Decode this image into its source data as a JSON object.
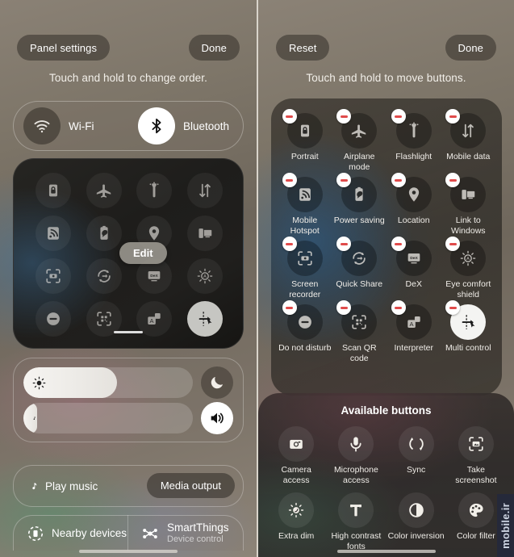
{
  "left_panel": {
    "panel_settings_label": "Panel settings",
    "done_label": "Done",
    "hint": "Touch and hold to change order.",
    "wifi": {
      "label": "Wi-Fi",
      "icon": "wifi-icon",
      "state": "off"
    },
    "bluetooth": {
      "label": "Bluetooth",
      "icon": "bluetooth-icon",
      "state": "on"
    },
    "edit_bubble_label": "Edit",
    "quick_grid": [
      {
        "icon": "portrait-lock-icon",
        "name": "portrait",
        "state": "off"
      },
      {
        "icon": "airplane-icon",
        "name": "airplane-mode",
        "state": "off"
      },
      {
        "icon": "flashlight-icon",
        "name": "flashlight",
        "state": "off"
      },
      {
        "icon": "mobile-data-icon",
        "name": "mobile-data",
        "state": "off"
      },
      {
        "icon": "hotspot-icon",
        "name": "mobile-hotspot",
        "state": "off"
      },
      {
        "icon": "power-saving-icon",
        "name": "power-saving",
        "state": "off"
      },
      {
        "icon": "location-pin-icon",
        "name": "location",
        "state": "off"
      },
      {
        "icon": "link-to-windows-icon",
        "name": "link-to-windows",
        "state": "off"
      },
      {
        "icon": "screen-recorder-icon",
        "name": "screen-recorder",
        "state": "off"
      },
      {
        "icon": "quick-share-icon",
        "name": "quick-share",
        "state": "off"
      },
      {
        "icon": "dex-icon",
        "name": "dex",
        "state": "off"
      },
      {
        "icon": "eye-comfort-shield-icon",
        "name": "eye-comfort-shield",
        "state": "off"
      },
      {
        "icon": "do-not-disturb-icon",
        "name": "do-not-disturb",
        "state": "off"
      },
      {
        "icon": "scan-qr-icon",
        "name": "scan-qr-code",
        "state": "off"
      },
      {
        "icon": "interpreter-icon",
        "name": "interpreter",
        "state": "off"
      },
      {
        "icon": "multi-control-icon",
        "name": "multi-control",
        "state": "on"
      }
    ],
    "brightness_slider": {
      "icon": "brightness-icon",
      "value_percent": 55,
      "side_icon": "moon-icon"
    },
    "volume_slider": {
      "icon": "media-note-icon",
      "value_percent": 8,
      "side_icon": "speaker-icon"
    },
    "media": {
      "play_music_label": "Play music",
      "note_icon": "music-note-icon",
      "media_output_label": "Media output"
    },
    "devices": {
      "nearby_label": "Nearby devices",
      "nearby_icon": "nearby-devices-icon",
      "smartthings_label": "SmartThings",
      "smartthings_sub": "Device control",
      "smartthings_icon": "smartthings-icon"
    }
  },
  "right_panel": {
    "reset_label": "Reset",
    "done_label": "Done",
    "hint": "Touch and hold to move buttons.",
    "active_buttons": [
      {
        "label": "Portrait",
        "icon": "portrait-lock-icon",
        "removable": true,
        "highlighted": false
      },
      {
        "label": "Airplane mode",
        "icon": "airplane-icon",
        "removable": true,
        "highlighted": false
      },
      {
        "label": "Flashlight",
        "icon": "flashlight-icon",
        "removable": true,
        "highlighted": false
      },
      {
        "label": "Mobile data",
        "icon": "mobile-data-icon",
        "removable": true,
        "highlighted": false
      },
      {
        "label": "Mobile Hotspot",
        "icon": "hotspot-icon",
        "removable": true,
        "highlighted": false
      },
      {
        "label": "Power saving",
        "icon": "power-saving-icon",
        "removable": true,
        "highlighted": false
      },
      {
        "label": "Location",
        "icon": "location-pin-icon",
        "removable": true,
        "highlighted": false
      },
      {
        "label": "Link to Windows",
        "icon": "link-to-windows-icon",
        "removable": true,
        "highlighted": false
      },
      {
        "label": "Screen recorder",
        "icon": "screen-recorder-icon",
        "removable": true,
        "highlighted": false
      },
      {
        "label": "Quick Share",
        "icon": "quick-share-icon",
        "removable": true,
        "highlighted": false
      },
      {
        "label": "DeX",
        "icon": "dex-icon",
        "removable": true,
        "highlighted": false
      },
      {
        "label": "Eye comfort shield",
        "icon": "eye-comfort-shield-icon",
        "removable": true,
        "highlighted": false
      },
      {
        "label": "Do not disturb",
        "icon": "do-not-disturb-icon",
        "removable": true,
        "highlighted": false
      },
      {
        "label": "Scan QR code",
        "icon": "scan-qr-icon",
        "removable": true,
        "highlighted": false
      },
      {
        "label": "Interpreter",
        "icon": "interpreter-icon",
        "removable": true,
        "highlighted": false
      },
      {
        "label": "Multi control",
        "icon": "multi-control-icon",
        "removable": true,
        "highlighted": true
      }
    ],
    "available": {
      "title": "Available buttons",
      "items": [
        {
          "label": "Camera access",
          "icon": "camera-icon"
        },
        {
          "label": "Microphone access",
          "icon": "microphone-icon"
        },
        {
          "label": "Sync",
          "icon": "sync-icon"
        },
        {
          "label": "Take screenshot",
          "icon": "screenshot-icon"
        },
        {
          "label": "Extra dim",
          "icon": "extra-dim-icon"
        },
        {
          "label": "High contrast fonts",
          "icon": "high-contrast-fonts-icon"
        },
        {
          "label": "Color inversion",
          "icon": "color-inversion-icon"
        },
        {
          "label": "Color filter",
          "icon": "color-filter-icon"
        }
      ],
      "page_count": 4,
      "page_active": 1
    }
  },
  "watermark": {
    "text": "mobile.ir"
  },
  "colors": {
    "accent_white": "#ffffff",
    "remove_badge": "#e04b4b",
    "panel_dark": "#1e1d1b",
    "background_warm": "#7d7568"
  }
}
